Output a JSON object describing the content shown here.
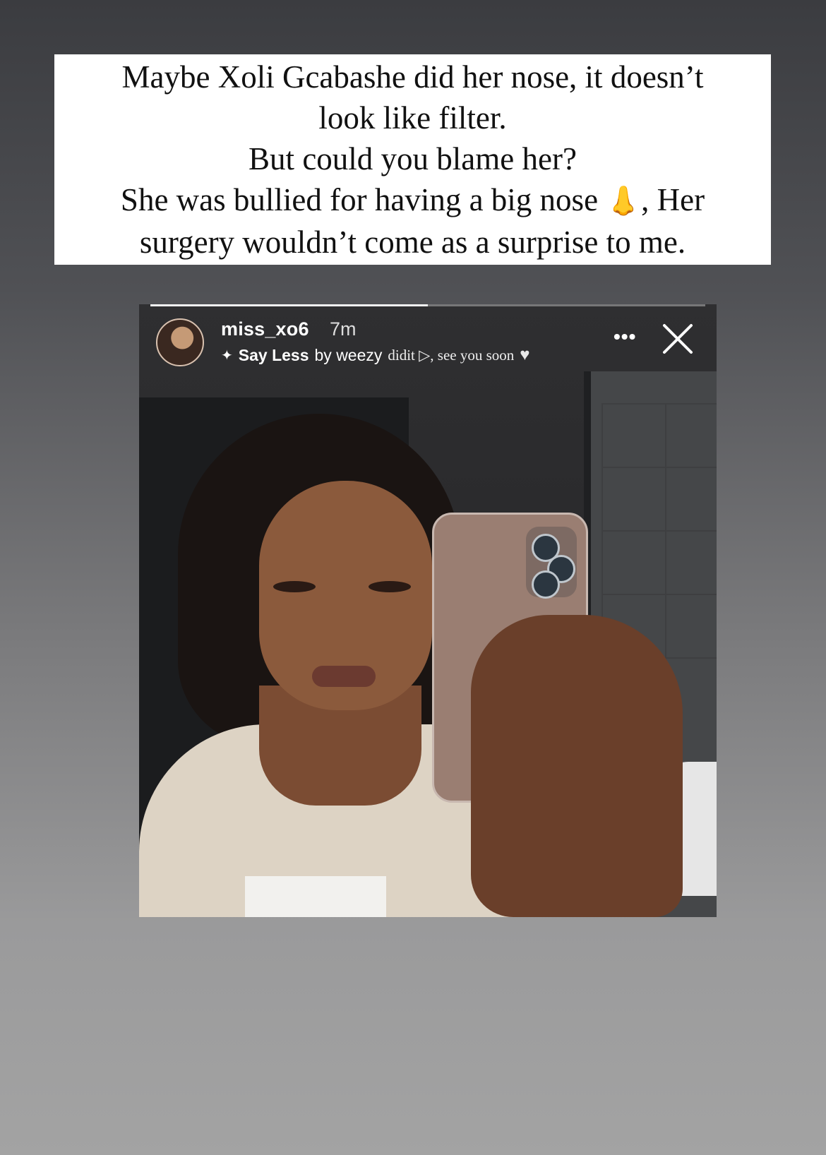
{
  "caption": {
    "lines": [
      "Maybe Xoli Gcabashe did her nose, it doesn’t",
      "look like filter.",
      "But could you blame her?",
      "She was bullied for having a big nose",
      "surgery wouldn’t come as a surprise to me."
    ],
    "emoji": "👃",
    "line4_tail": ", Her"
  },
  "story": {
    "username": "miss_xo6",
    "time": "7m",
    "music": {
      "icon": "sparkle-icon",
      "title": "Say Less",
      "artist": "by weezy",
      "extra": "didit ▷, see you soon"
    },
    "more_label": "•••",
    "progress": 0.5,
    "colors": {
      "progress_track": "#9a9a9a",
      "progress_fill": "#f4f4f4"
    }
  }
}
